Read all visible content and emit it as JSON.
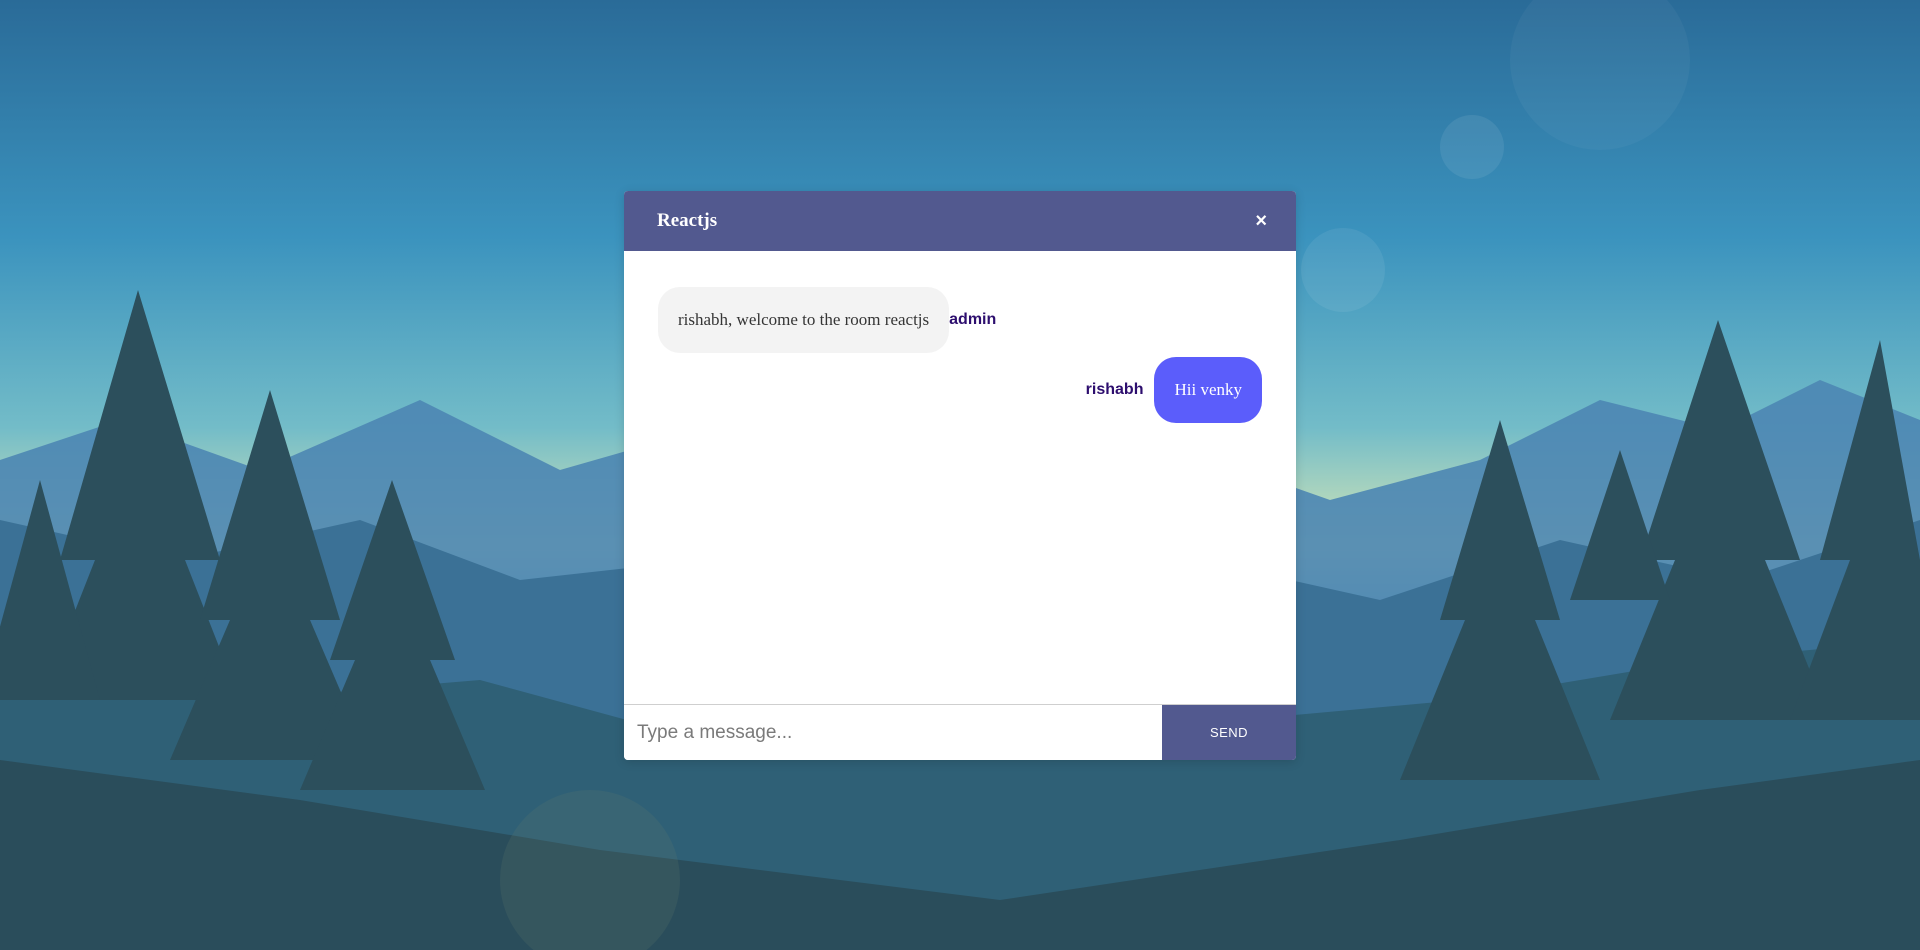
{
  "header": {
    "room_title": "Reactjs",
    "close_label": "×"
  },
  "messages": [
    {
      "direction": "received",
      "text": "rishabh, welcome to the room reactjs",
      "sender": "admin"
    },
    {
      "direction": "sent",
      "text": "Hii venky",
      "sender": "rishabh"
    }
  ],
  "composer": {
    "placeholder": "Type a message...",
    "value": "",
    "send_label": "SEND"
  },
  "colors": {
    "header": "#52598f",
    "sent_bubble": "#5b5dfb",
    "received_bubble": "#f3f3f3",
    "sender_name": "#2d0e6e"
  }
}
